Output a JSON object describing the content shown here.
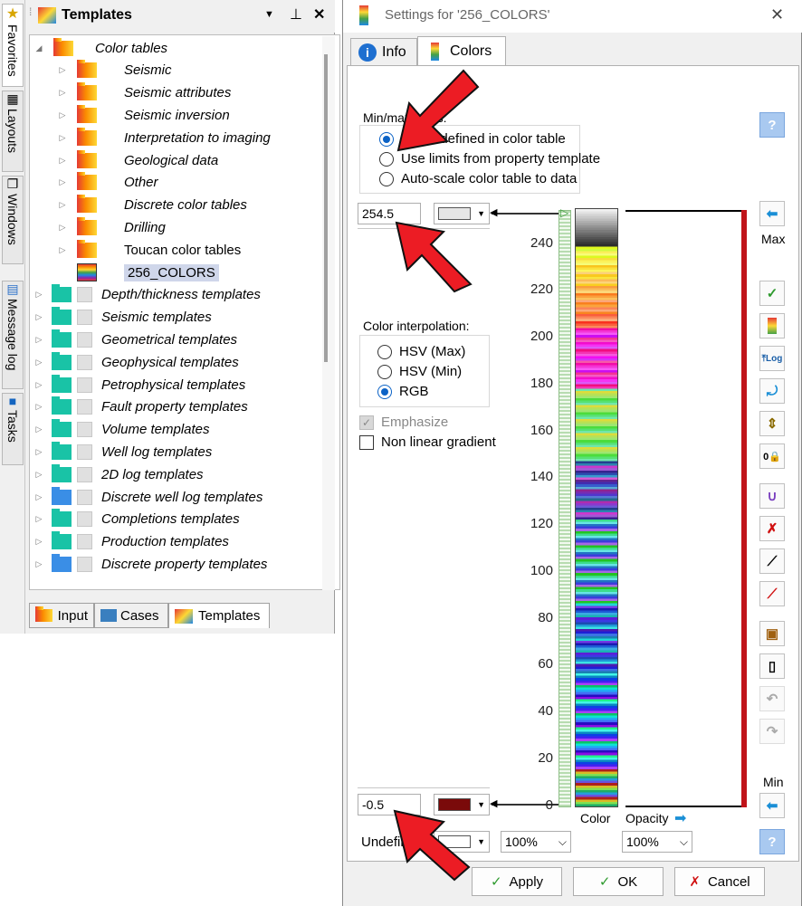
{
  "side_tabs": [
    "Favorites",
    "Layouts",
    "Windows",
    "Message log",
    "Tasks"
  ],
  "panel": {
    "title": "Templates",
    "pin_icon": "pin-icon",
    "close_glyph": "✕"
  },
  "tree": [
    {
      "label": "Color tables",
      "level": 0,
      "expand": "open",
      "icon": "red"
    },
    {
      "label": "Seismic",
      "level": 1,
      "expand": "closed",
      "icon": "red"
    },
    {
      "label": "Seismic attributes",
      "level": 1,
      "expand": "closed",
      "icon": "red"
    },
    {
      "label": "Seismic inversion",
      "level": 1,
      "expand": "closed",
      "icon": "red"
    },
    {
      "label": "Interpretation to imaging",
      "level": 1,
      "expand": "closed",
      "icon": "red"
    },
    {
      "label": "Geological data",
      "level": 1,
      "expand": "closed",
      "icon": "red"
    },
    {
      "label": "Other",
      "level": 1,
      "expand": "closed",
      "icon": "red"
    },
    {
      "label": "Discrete color tables",
      "level": 1,
      "expand": "closed",
      "icon": "red"
    },
    {
      "label": "Drilling",
      "level": 1,
      "expand": "closed",
      "icon": "red"
    },
    {
      "label": "Toucan color tables",
      "level": 1,
      "expand": "closed",
      "icon": "red",
      "upright": true
    },
    {
      "label": "256_COLORS",
      "level": 1,
      "expand": "none",
      "icon": "stripes",
      "upright": true,
      "selected": true
    },
    {
      "label": "Depth/thickness templates",
      "level": 0,
      "expand": "closed",
      "icon": "teal",
      "check": true
    },
    {
      "label": "Seismic templates",
      "level": 0,
      "expand": "closed",
      "icon": "teal",
      "check": true
    },
    {
      "label": "Geometrical templates",
      "level": 0,
      "expand": "closed",
      "icon": "teal",
      "check": true
    },
    {
      "label": "Geophysical templates",
      "level": 0,
      "expand": "closed",
      "icon": "teal",
      "check": true
    },
    {
      "label": "Petrophysical templates",
      "level": 0,
      "expand": "closed",
      "icon": "teal",
      "check": true
    },
    {
      "label": "Fault property templates",
      "level": 0,
      "expand": "closed",
      "icon": "teal",
      "check": true
    },
    {
      "label": "Volume templates",
      "level": 0,
      "expand": "closed",
      "icon": "teal",
      "check": true
    },
    {
      "label": "Well log templates",
      "level": 0,
      "expand": "closed",
      "icon": "teal",
      "check": true
    },
    {
      "label": "2D log templates",
      "level": 0,
      "expand": "closed",
      "icon": "teal",
      "check": true
    },
    {
      "label": "Discrete well log templates",
      "level": 0,
      "expand": "closed",
      "icon": "blue",
      "check": true
    },
    {
      "label": "Completions templates",
      "level": 0,
      "expand": "closed",
      "icon": "teal",
      "check": true
    },
    {
      "label": "Production templates",
      "level": 0,
      "expand": "closed",
      "icon": "teal",
      "check": true
    },
    {
      "label": "Discrete property templates",
      "level": 0,
      "expand": "closed",
      "icon": "blue",
      "check": true
    }
  ],
  "bottom_tabs": [
    "Input",
    "Cases",
    "Templates"
  ],
  "dialog": {
    "title": "Settings for '256_COLORS'",
    "close_glyph": "✕",
    "tabs": [
      "Info",
      "Colors"
    ],
    "limits_label": "Min/max limits:",
    "limit_options": [
      "Limits defined in color table",
      "Use limits from property template",
      "Auto-scale color table to data"
    ],
    "max_value": "254.5",
    "min_value": "-0.5",
    "max_color": "#e6e6e6",
    "min_color": "#7a0a0a",
    "interp_label": "Color interpolation:",
    "interp_options": [
      "HSV (Max)",
      "HSV (Min)",
      "RGB"
    ],
    "emphasize": "Emphasize",
    "nonlinear": "Non linear gradient",
    "undefined_label": "Undefined:",
    "pct_1": "100%",
    "pct_2": "100%",
    "color_label": "Color",
    "opacity_label": "Opacity",
    "max_label": "Max",
    "min_label": "Min",
    "help": "?",
    "apply": "Apply",
    "ok": "OK",
    "cancel": "Cancel",
    "accent": "#0b62c6",
    "axis_ticks": [
      "240",
      "220",
      "200",
      "180",
      "160",
      "140",
      "120",
      "100",
      "80",
      "60",
      "40",
      "20",
      "0"
    ]
  }
}
